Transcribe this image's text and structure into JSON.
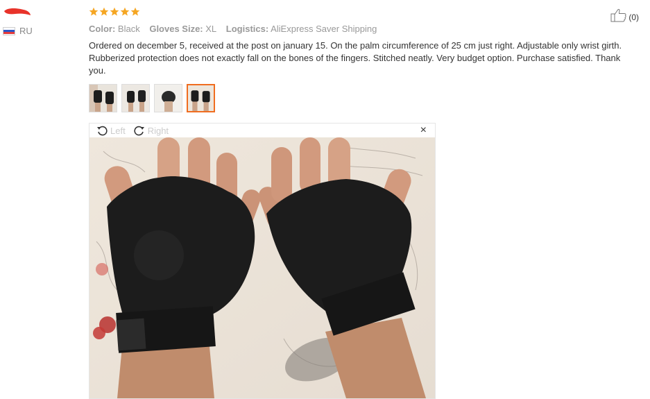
{
  "reviewer": {
    "country_code": "RU",
    "flag_colors": [
      "#ffffff",
      "#2b56c6",
      "#e33b3b"
    ]
  },
  "rating": {
    "stars": 5,
    "max": 5,
    "color": "#f5a623"
  },
  "attributes": [
    {
      "label": "Color:",
      "value": "Black"
    },
    {
      "label": "Gloves Size:",
      "value": "XL"
    },
    {
      "label": "Logistics:",
      "value": "AliExpress Saver Shipping"
    }
  ],
  "review_text": "Ordered on december 5, received at the post on january 15. On the palm circumference of 25 cm just right. Adjustable only wrist girth. Rubberized protection does not exactly fall on the bones of the fingers. Stitched neatly. Very budget option. Purchase satisfied. Thank you.",
  "helpful": {
    "count_text": "(0)",
    "icon": "thumbs-up-icon"
  },
  "thumbnails": {
    "count": 4,
    "selected_index": 3,
    "accent": "#f06d1f"
  },
  "viewer": {
    "rotate_left_label": "Left",
    "rotate_right_label": "Right",
    "close_symbol": "×"
  }
}
